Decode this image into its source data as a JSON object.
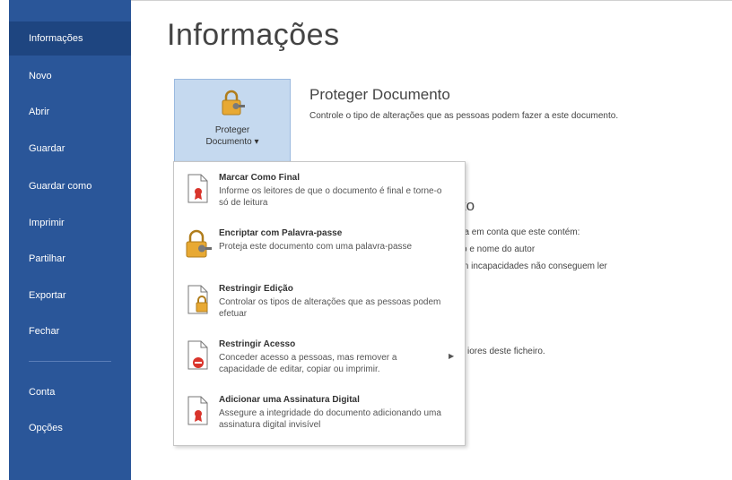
{
  "nav": {
    "items": [
      {
        "label": "Informações",
        "active": true
      },
      {
        "label": "Novo"
      },
      {
        "label": "Abrir"
      },
      {
        "label": "Guardar"
      },
      {
        "label": "Guardar como"
      },
      {
        "label": "Imprimir"
      },
      {
        "label": "Partilhar"
      },
      {
        "label": "Exportar"
      },
      {
        "label": "Fechar"
      },
      {
        "label": "Conta"
      },
      {
        "label": "Opções"
      }
    ]
  },
  "page": {
    "title": "Informações"
  },
  "protect": {
    "button_line1": "Proteger",
    "button_line2": "Documento ▾",
    "title": "Proteger Documento",
    "description": "Controle o tipo de alterações que as pessoas podem fazer a este documento."
  },
  "background": {
    "heading_fragment": "ento",
    "line1": "tenha em conta que este contém:",
    "line2": "ito e nome do autor",
    "line3": "m incapacidades não conseguem ler",
    "line4": "iores deste ficheiro."
  },
  "menu": {
    "items": [
      {
        "title": "Marcar Como Final",
        "desc": "Informe os leitores de que o documento é final e torne-o só de leitura",
        "icon": "mark-final-icon"
      },
      {
        "title": "Encriptar com Palavra-passe",
        "desc": "Proteja este documento com uma palavra-passe",
        "icon": "encrypt-lock-icon"
      },
      {
        "title": "Restringir Edição",
        "desc": "Controlar os tipos de alterações que as pessoas podem efetuar",
        "icon": "restrict-editing-icon"
      },
      {
        "title": "Restringir Acesso",
        "desc": "Conceder acesso a pessoas, mas remover a capacidade de editar, copiar ou imprimir.",
        "icon": "restrict-access-icon",
        "has_submenu": true
      },
      {
        "title": "Adicionar uma Assinatura Digital",
        "desc": "Assegure a integridade do documento adicionando uma assinatura digital invisível",
        "icon": "digital-signature-icon"
      }
    ]
  },
  "colors": {
    "sidebar": "#2a5699",
    "sidebar_active": "#1e4580",
    "button_bg": "#c5d9ef",
    "lock": "#e8a933"
  }
}
